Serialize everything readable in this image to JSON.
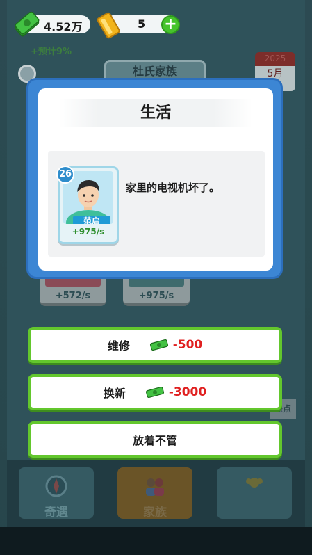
{
  "hud": {
    "money": "4.52万",
    "gold": "5",
    "add": "+"
  },
  "background": {
    "hint_text": "+预计9%",
    "family_name": "杜氏家族",
    "calendar_year": "2025",
    "calendar_month": "5月",
    "cards": [
      {
        "income": "+572/s"
      },
      {
        "income": "+975/s"
      }
    ],
    "side_label": "盖点",
    "nav": [
      {
        "label": "奇遇"
      },
      {
        "label": "家族"
      },
      {
        "label": ""
      }
    ]
  },
  "modal": {
    "title": "生活",
    "character": {
      "age": "26",
      "name": "范启",
      "income": "+975/s"
    },
    "event_text": "家里的电视机坏了。"
  },
  "options": [
    {
      "label": "维修",
      "cost": "-500"
    },
    {
      "label": "换新",
      "cost": "-3000"
    },
    {
      "label": "放着不管",
      "cost": ""
    }
  ],
  "colors": {
    "modal_border": "#3c86d4",
    "option_border": "#63c72d",
    "cost_red": "#e02020"
  }
}
